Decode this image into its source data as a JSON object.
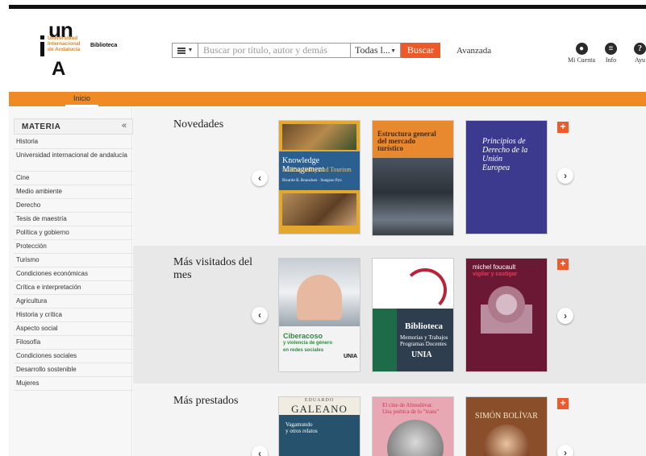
{
  "header": {
    "logo": {
      "un": "un",
      "institution_lines": [
        "Universidad",
        "Internacional",
        "de Andalucía"
      ],
      "biblioteca": "Biblioteca",
      "letter": "A"
    },
    "search": {
      "placeholder": "Buscar por título, autor y demás",
      "scope": "Todas l...",
      "button": "Buscar"
    },
    "advanced": "Avanzada",
    "icons": [
      {
        "icon": "user-icon",
        "label": "Mi Cuenta"
      },
      {
        "icon": "info-icon",
        "label": "Info"
      },
      {
        "icon": "help-icon",
        "label": "Ayu"
      }
    ]
  },
  "nav": {
    "home": "Inicio"
  },
  "sidebar": {
    "title": "MATERIA",
    "collapse": "«",
    "items": [
      "Historia",
      "Universidad internacional de andalucía",
      "Cine",
      "Medio ambiente",
      "Derecho",
      "Tesis de maestría",
      "Política y gobierno",
      "Protección",
      "Turismo",
      "Condiciones económicas",
      "Crítica e interpretación",
      "Agricultura",
      "Historia y crítica",
      "Aspecto social",
      "Filosofía",
      "Condiciones sociales",
      "Desarrollo sostenible",
      "Mujeres"
    ]
  },
  "carousels": [
    {
      "title": "Novedades",
      "books": [
        {
          "cover_lines": [
            "Knowledge Management",
            "in Hospitality and Tourism"
          ],
          "cover_author": "Ricardo B. Bouncken · Sungsoo Pyo"
        },
        {
          "cover_lines": [
            "Estructura general",
            "del mercado",
            "turístico"
          ],
          "cover_author": ""
        },
        {
          "cover_lines": [
            "Principios de",
            "Derecho de la Unión",
            "Europea"
          ],
          "cover_author": ""
        }
      ]
    },
    {
      "title": "Más visitados del mes",
      "books": [
        {
          "cover_lines": [
            "Ciberacoso",
            "y violencia de género",
            "en redes sociales"
          ],
          "cover_author": "UNIA"
        },
        {
          "cover_lines": [
            "Biblioteca",
            "Memorias y Trabajos",
            "Programas Docentes",
            "UNIA"
          ],
          "cover_author": ""
        },
        {
          "cover_lines": [
            "michel foucault",
            "vigilar y castigar"
          ],
          "cover_author": ""
        }
      ]
    },
    {
      "title": "Más prestados",
      "books": [
        {
          "cover_lines": [
            "EDUARDO",
            "GALEANO",
            "Vagamundo",
            "y otros relatos"
          ],
          "cover_author": ""
        },
        {
          "cover_lines": [
            "El cine de Almodóvar.",
            "Una poética de lo \"trans\""
          ],
          "cover_author": ""
        },
        {
          "cover_lines": [
            "SIMÓN BOLÍVAR"
          ],
          "cover_author": ""
        }
      ]
    }
  ],
  "controls": {
    "prev": "‹",
    "next": "›",
    "add": "+"
  },
  "colors": {
    "accent_orange": "#ef8a24",
    "search_button": "#ec5a2a"
  }
}
